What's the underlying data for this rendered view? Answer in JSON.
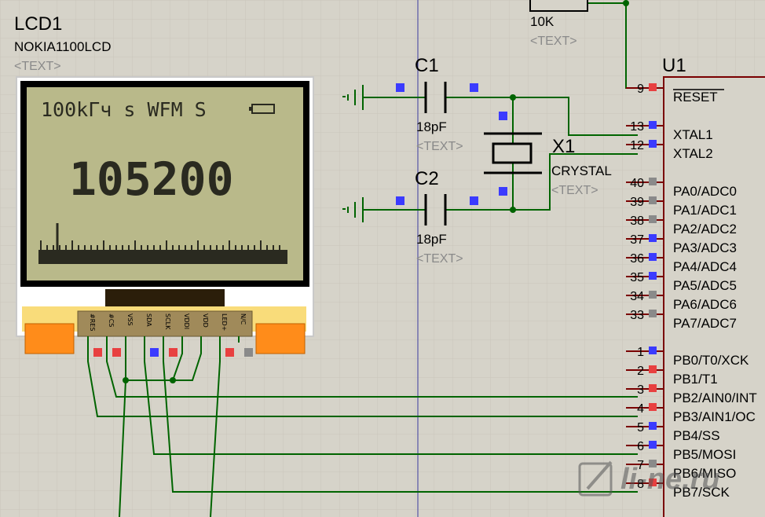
{
  "lcd": {
    "ref": "LCD1",
    "part": "NOKIA1100LCD",
    "text_placeholder": "<TEXT>",
    "screen_status": "100kГч s WFM S",
    "screen_frequency": "105200",
    "connector_pins": [
      "#RES",
      "#CS",
      "VSS",
      "SDA",
      "SCLK",
      "VDDI",
      "VDD",
      "LED+",
      "N/C"
    ]
  },
  "resistor": {
    "value": "10K",
    "text_placeholder": "<TEXT>"
  },
  "c1": {
    "ref": "C1",
    "value": "18pF",
    "text_placeholder": "<TEXT>"
  },
  "c2": {
    "ref": "C2",
    "value": "18pF",
    "text_placeholder": "<TEXT>"
  },
  "x1": {
    "ref": "X1",
    "part": "CRYSTAL",
    "text_placeholder": "<TEXT>"
  },
  "u1": {
    "ref": "U1",
    "pins": [
      {
        "num": "9",
        "name": "RESET",
        "marker": "red"
      },
      {
        "num": "13",
        "name": "XTAL1",
        "marker": "blue"
      },
      {
        "num": "12",
        "name": "XTAL2",
        "marker": "blue"
      },
      {
        "num": "40",
        "name": "PA0/ADC0",
        "marker": "gray"
      },
      {
        "num": "39",
        "name": "PA1/ADC1",
        "marker": "gray"
      },
      {
        "num": "38",
        "name": "PA2/ADC2",
        "marker": "gray"
      },
      {
        "num": "37",
        "name": "PA3/ADC3",
        "marker": "blue"
      },
      {
        "num": "36",
        "name": "PA4/ADC4",
        "marker": "blue"
      },
      {
        "num": "35",
        "name": "PA5/ADC5",
        "marker": "blue"
      },
      {
        "num": "34",
        "name": "PA6/ADC6",
        "marker": "gray"
      },
      {
        "num": "33",
        "name": "PA7/ADC7",
        "marker": "gray"
      },
      {
        "num": "1",
        "name": "PB0/T0/XCK",
        "marker": "blue"
      },
      {
        "num": "2",
        "name": "PB1/T1",
        "marker": "red"
      },
      {
        "num": "3",
        "name": "PB2/AIN0/INT",
        "marker": "red"
      },
      {
        "num": "4",
        "name": "PB3/AIN1/OC",
        "marker": "red"
      },
      {
        "num": "5",
        "name": "PB4/SS",
        "marker": "blue"
      },
      {
        "num": "6",
        "name": "PB5/MOSI",
        "marker": "blue"
      },
      {
        "num": "7",
        "name": "PB6/MISO",
        "marker": "gray"
      },
      {
        "num": "8",
        "name": "PB7/SCK",
        "marker": "red"
      }
    ]
  },
  "watermark": {
    "text": "li-ne.ru"
  },
  "colors": {
    "wire": "#006400",
    "marker_red": "#e84040",
    "marker_blue": "#3b3bff",
    "marker_gray": "#8a8a8a",
    "lcd_screen": "#b9b98a",
    "lcd_board": "#f9dc7a",
    "connector": "#a08a5a",
    "orange_pad": "#ff8c1a",
    "chip_line": "#7a0000"
  }
}
